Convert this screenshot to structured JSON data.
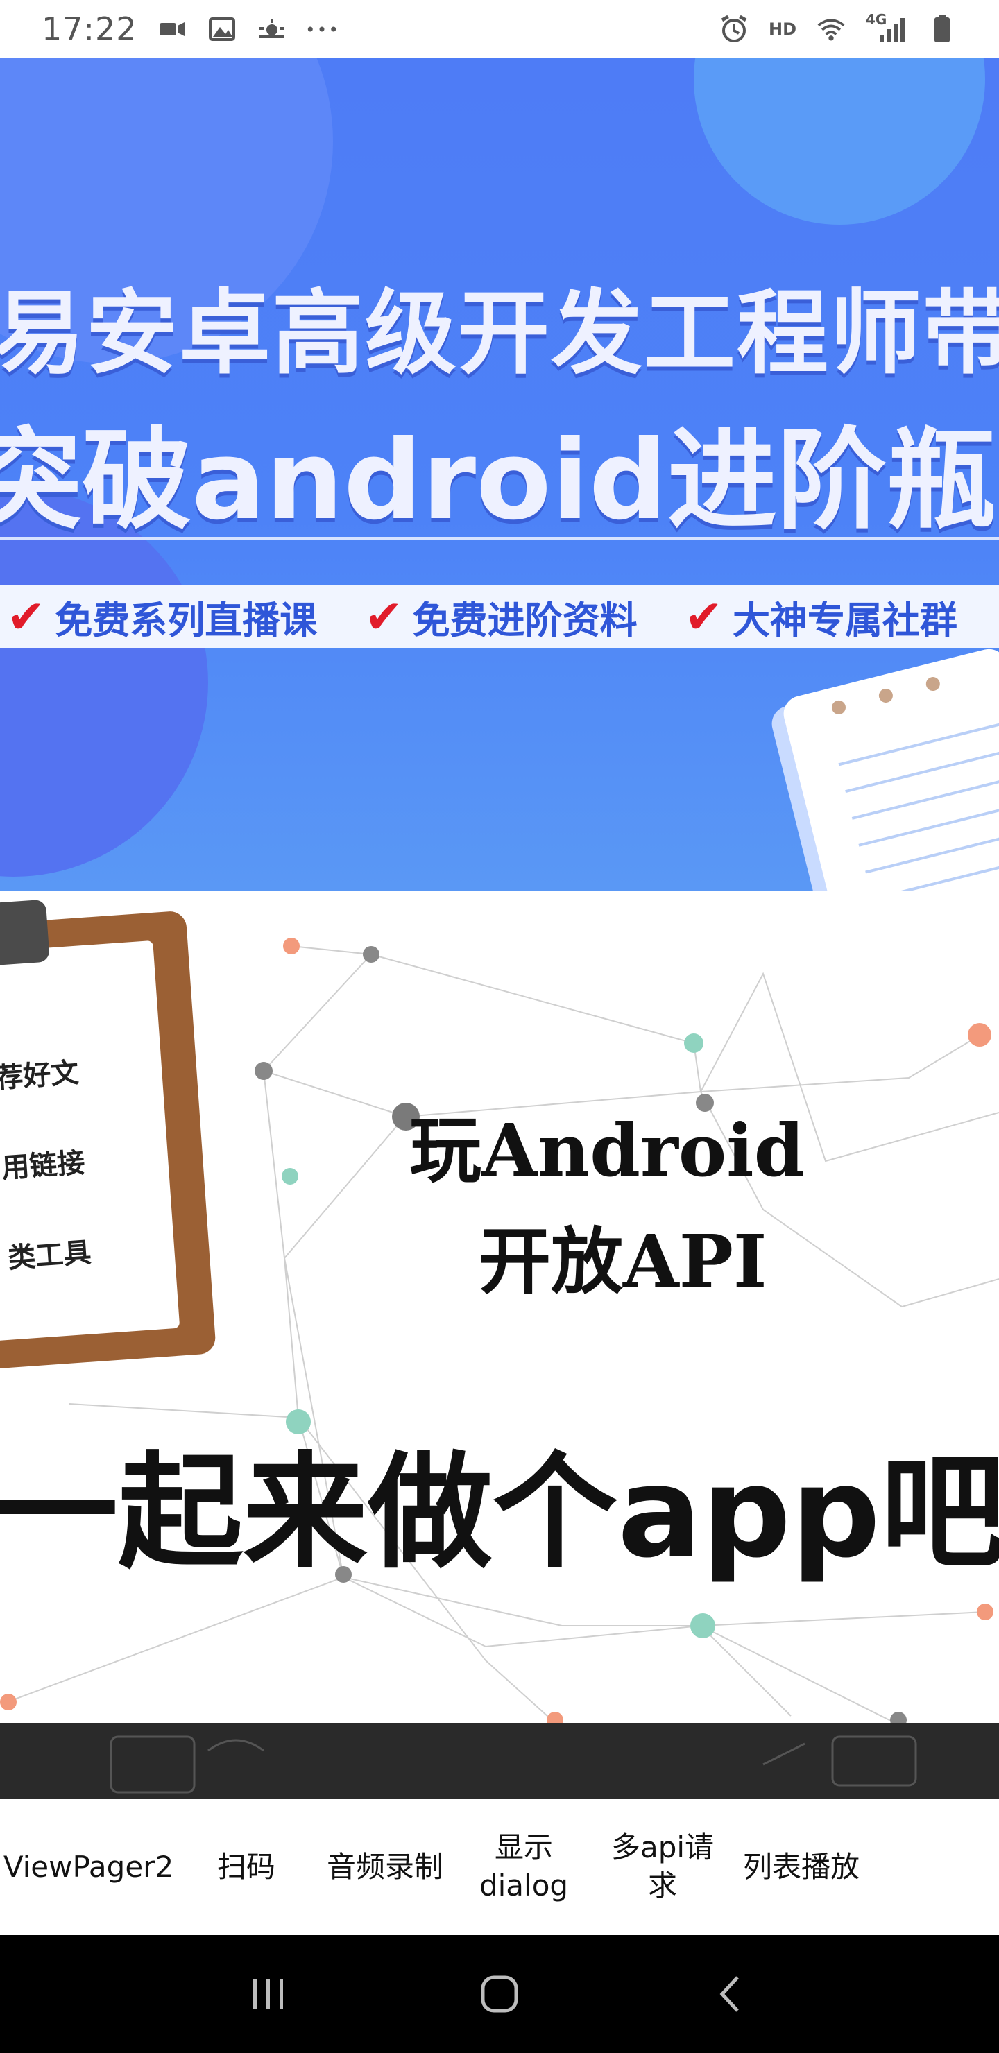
{
  "status_bar": {
    "time": "17:22",
    "hd": "HD",
    "network": "4G",
    "icons": [
      "video-icon",
      "image-icon",
      "weather-icon",
      "more-dots-icon",
      "alarm-icon",
      "wifi-icon",
      "signal-icon",
      "battery-icon"
    ]
  },
  "banner1": {
    "line1": "易安卓高级开发工程师带",
    "line2": "突破android进阶瓶",
    "tags": [
      "免费系列直播课",
      "免费进阶资料",
      "大神专属社群"
    ],
    "colors": {
      "background": "#4e7cf6",
      "tag_text": "#2f56d8",
      "check": "#e11b2a"
    }
  },
  "banner2": {
    "title_line1": "玩Android",
    "title_line2": "开放API",
    "big_text": "一起来做个app吧",
    "clipboard_items": [
      "荐好文",
      "用链接",
      "类工具"
    ]
  },
  "tabs": [
    {
      "label": "ViewPager2"
    },
    {
      "label": "扫码"
    },
    {
      "label": "音频录制"
    },
    {
      "label": "显示\ndialog"
    },
    {
      "label": "多api请\n求"
    },
    {
      "label": "列表播放"
    }
  ],
  "nav_bar": {
    "icons": [
      "recent-apps-icon",
      "home-icon",
      "back-icon"
    ]
  }
}
